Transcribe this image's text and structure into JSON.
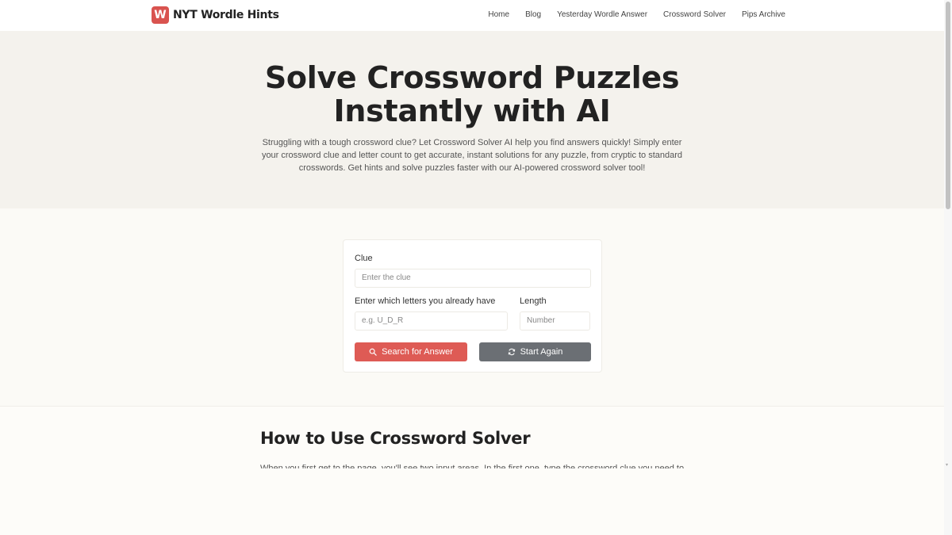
{
  "header": {
    "logo_letter": "W",
    "logo_text": "NYT Wordle Hints",
    "nav": [
      {
        "label": "Home"
      },
      {
        "label": "Blog"
      },
      {
        "label": "Yesterday Wordle Answer"
      },
      {
        "label": "Crossword Solver"
      },
      {
        "label": "Pips Archive"
      }
    ]
  },
  "hero": {
    "title_line1": "Solve Crossword Puzzles",
    "title_line2": "Instantly with AI",
    "description": "Struggling with a tough crossword clue? Let Crossword Solver AI help you find answers quickly! Simply enter your crossword clue and letter count to get accurate, instant solutions for any puzzle, from cryptic to standard crosswords. Get hints and solve puzzles faster with our AI-powered crossword solver tool!"
  },
  "form": {
    "clue_label": "Clue",
    "clue_placeholder": "Enter the clue",
    "letters_label": "Enter which letters you already have",
    "letters_placeholder": "e.g. U_D_R",
    "length_label": "Length",
    "length_placeholder": "Number",
    "search_button": "Search for Answer",
    "reset_button": "Start Again"
  },
  "section": {
    "title": "How to Use Crossword Solver",
    "text": "When you first get to the page, you'll see two input areas. In the first one, type the crossword clue you need to"
  },
  "colors": {
    "brand": "#de5b55",
    "secondary_button": "#6b6f74",
    "hero_bg": "#f4f2ed"
  }
}
